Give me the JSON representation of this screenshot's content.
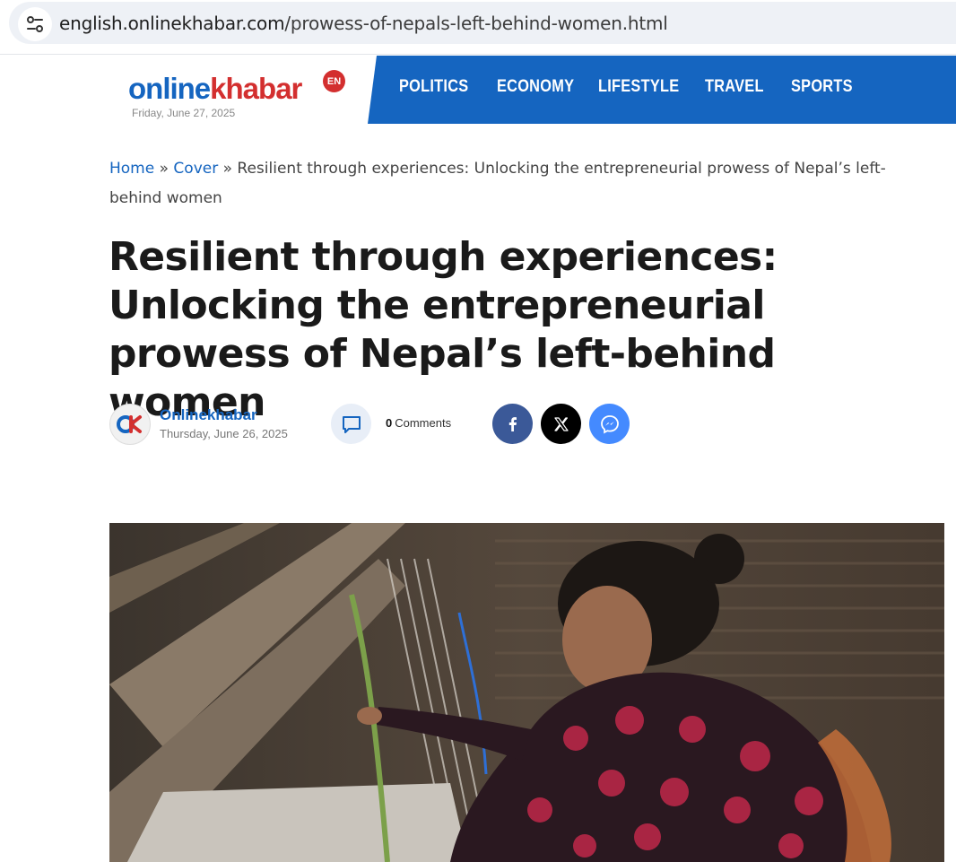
{
  "browser": {
    "url_host": "english.onlinekhabar.com",
    "url_path": "/prowess-of-nepals-left-behind-women.html",
    "site_info_icon": "tune-icon"
  },
  "site": {
    "logo_online": "online",
    "logo_khabar": "khabar",
    "logo_badge": "EN",
    "header_date": "Friday, June 27, 2025",
    "brand_blue": "#1565c0",
    "brand_red": "#d32f2f"
  },
  "nav": {
    "items": [
      "POLITICS",
      "ECONOMY",
      "LIFESTYLE",
      "TRAVEL",
      "SPORTS"
    ]
  },
  "breadcrumb": {
    "home": "Home",
    "sep1": " » ",
    "cover": "Cover",
    "sep2": " » ",
    "current": "Resilient through experiences: Unlocking the entrepreneurial prowess of Nepal’s left-behind women"
  },
  "article": {
    "title": "Resilient through experiences: Unlocking the entrepreneurial prowess of Nepal’s left-behind women",
    "author": "Onlinekhabar",
    "date": "Thursday, June 26, 2025",
    "comment_count": "0",
    "comment_label": "Comments",
    "avatar_logo": "OK"
  },
  "share": {
    "facebook_icon": "facebook-icon",
    "x_icon": "x-icon",
    "messenger_icon": "messenger-icon"
  },
  "hero_image": {
    "subject": "woman-weaving-at-loom-photo"
  }
}
